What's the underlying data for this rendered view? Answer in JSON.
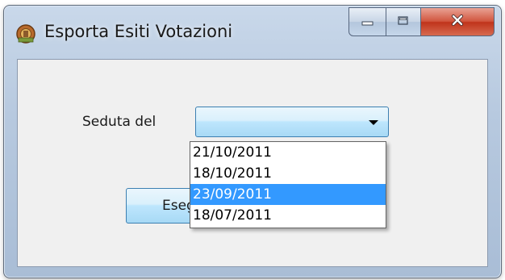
{
  "window": {
    "title": "Esporta Esiti Votazioni"
  },
  "form": {
    "seduta_label": "Seduta del",
    "seduta_value": "",
    "execute_label": "Esegui"
  },
  "dropdown": {
    "items": [
      "21/10/2011",
      "18/10/2011",
      "23/09/2011",
      "18/07/2011"
    ],
    "highlighted": "23/09/2011"
  },
  "colors": {
    "selection": "#3399ff",
    "close_button": "#c0341b"
  }
}
